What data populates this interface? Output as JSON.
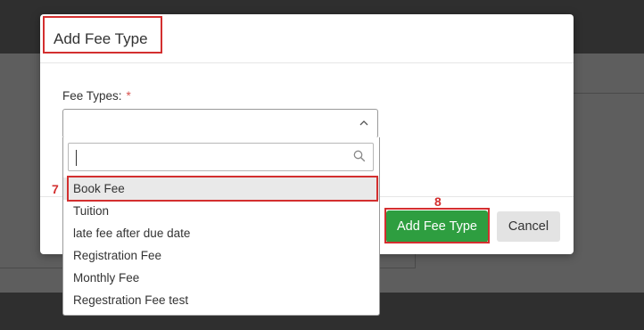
{
  "modal": {
    "title": "Add Fee Type",
    "field_label": "Fee Types:",
    "required_mark": "*",
    "primary_button": "Add Fee Type",
    "cancel_button": "Cancel"
  },
  "dropdown": {
    "search_placeholder": "",
    "options": [
      "Book Fee",
      "Tuition",
      "late fee after due date",
      "Registration Fee",
      "Monthly Fee",
      "Regestration Fee test"
    ],
    "highlighted_index": 0
  },
  "annotations": {
    "step_option": "7",
    "step_button": "8"
  },
  "colors": {
    "primary": "#2e9e40",
    "annotation": "#d32f2f"
  },
  "icons": {
    "caret": "chevron-up-icon",
    "search": "search-icon"
  }
}
